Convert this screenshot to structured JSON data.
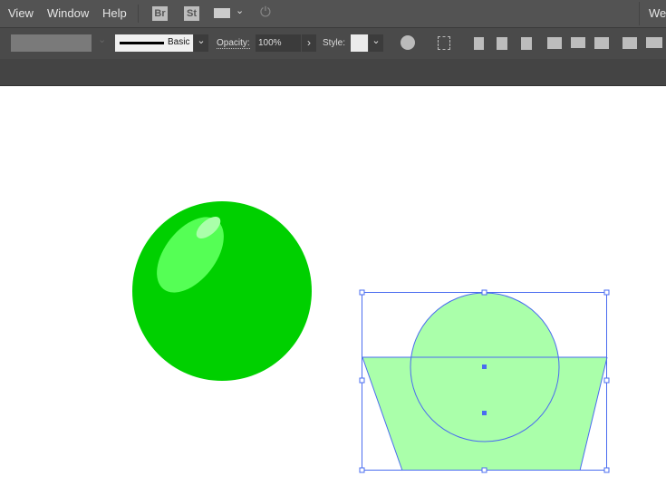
{
  "menu": {
    "items": [
      "View",
      "Window",
      "Help"
    ],
    "bridge": "Br",
    "stock": "St",
    "workspace": "We"
  },
  "control": {
    "stroke_profile": "Basic",
    "opacity_label": "Opacity:",
    "opacity_value": "100%",
    "style_label": "Style:"
  },
  "canvas": {
    "ball_color": "#00d000",
    "selected_fill": "#aaffaa",
    "selection_color": "#4a6cf0"
  }
}
